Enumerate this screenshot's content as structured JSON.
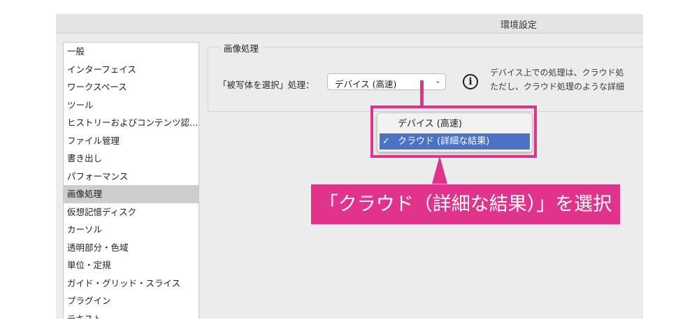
{
  "window": {
    "title": "環境設定"
  },
  "sidebar": {
    "items": [
      {
        "label": "一般"
      },
      {
        "label": "インターフェイス"
      },
      {
        "label": "ワークスペース"
      },
      {
        "label": "ツール"
      },
      {
        "label": "ヒストリーおよびコンテンツ認…"
      },
      {
        "label": "ファイル管理"
      },
      {
        "label": "書き出し"
      },
      {
        "label": "パフォーマンス"
      },
      {
        "label": "画像処理",
        "selected": true
      },
      {
        "label": "仮想記憶ディスク"
      },
      {
        "label": "カーソル"
      },
      {
        "label": "透明部分・色域"
      },
      {
        "label": "単位・定規"
      },
      {
        "label": "ガイド・グリッド・スライス"
      },
      {
        "label": "プラグイン"
      },
      {
        "label": "テキスト"
      }
    ]
  },
  "panel": {
    "group_title": "画像処理",
    "field_label": "「被写体を選択」処理：",
    "select_value": "デバイス (高速)",
    "description_line1": "デバイス上での処理は、クラウド処",
    "description_line2": "ただし、クラウド処理のような詳細"
  },
  "dropdown": {
    "options": [
      {
        "label": "デバイス (高速)",
        "checked": false
      },
      {
        "label": "クラウド (詳細な結果)",
        "checked": true
      }
    ],
    "check_mark": "✓"
  },
  "annotation": {
    "text": "「クラウド（詳細な結果）」を選択",
    "color": "#e0338c"
  },
  "icons": {
    "info": "info-circle-icon",
    "select_chevron": "chevron-down-icon"
  }
}
